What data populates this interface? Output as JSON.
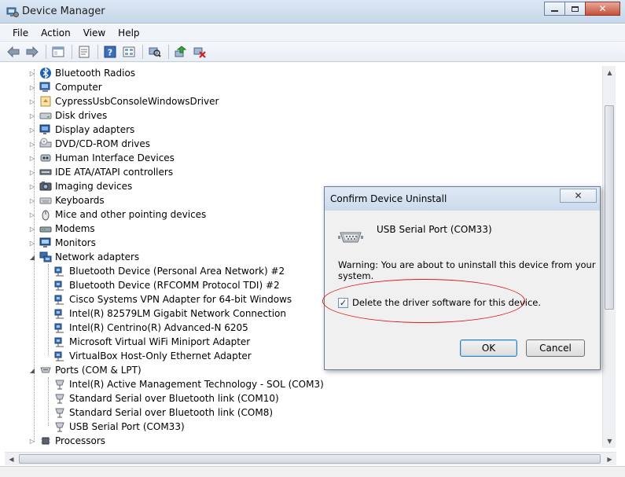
{
  "window": {
    "title": "Device Manager",
    "minimize_icon": "minimize-icon",
    "maximize_icon": "maximize-icon",
    "close_icon": "close-icon",
    "close_glyph": "✕"
  },
  "menu": [
    "File",
    "Action",
    "View",
    "Help"
  ],
  "toolbar": {
    "buttons": [
      "back-icon",
      "forward-icon",
      "console-tree-icon",
      "properties-icon",
      "help-icon",
      "view-icon",
      "scan-hardware-icon",
      "update-driver-icon",
      "uninstall-icon"
    ]
  },
  "tree": {
    "categories": [
      {
        "label": "Bluetooth Radios",
        "icon": "bluetooth-icon"
      },
      {
        "label": "Computer",
        "icon": "computer-icon"
      },
      {
        "label": "CypressUsbConsoleWindowsDriver",
        "icon": "driver-icon"
      },
      {
        "label": "Disk drives",
        "icon": "disk-drive-icon"
      },
      {
        "label": "Display adapters",
        "icon": "display-adapter-icon"
      },
      {
        "label": "DVD/CD-ROM drives",
        "icon": "dvd-drive-icon"
      },
      {
        "label": "Human Interface Devices",
        "icon": "hid-icon"
      },
      {
        "label": "IDE ATA/ATAPI controllers",
        "icon": "ide-controller-icon"
      },
      {
        "label": "Imaging devices",
        "icon": "camera-icon"
      },
      {
        "label": "Keyboards",
        "icon": "keyboard-icon"
      },
      {
        "label": "Mice and other pointing devices",
        "icon": "mouse-icon"
      },
      {
        "label": "Modems",
        "icon": "modem-icon"
      },
      {
        "label": "Monitors",
        "icon": "monitor-icon"
      }
    ],
    "network": {
      "label": "Network adapters",
      "icon": "network-adapter-icon",
      "children": [
        "Bluetooth Device (Personal Area Network) #2",
        "Bluetooth Device (RFCOMM Protocol TDI) #2",
        "Cisco Systems VPN Adapter for 64-bit Windows",
        "Intel(R) 82579LM Gigabit Network Connection",
        "Intel(R) Centrino(R) Advanced-N 6205",
        "Microsoft Virtual WiFi Miniport Adapter",
        "VirtualBox Host-Only Ethernet Adapter"
      ]
    },
    "ports": {
      "label": "Ports (COM & LPT)",
      "icon": "port-icon",
      "children": [
        "Intel(R) Active Management Technology - SOL (COM3)",
        "Standard Serial over Bluetooth link (COM10)",
        "Standard Serial over Bluetooth link (COM8)",
        "USB Serial Port (COM33)"
      ]
    },
    "processors": {
      "label": "Processors",
      "icon": "processor-icon"
    }
  },
  "dialog": {
    "title": "Confirm Device Uninstall",
    "close_glyph": "✕",
    "device_name": "USB Serial Port (COM33)",
    "device_icon": "serial-port-icon",
    "warning": "Warning: You are about to uninstall this device from your system.",
    "checkbox_label": "Delete the driver software for this device.",
    "checkbox_checked": true,
    "checkbox_glyph": "✓",
    "ok_label": "OK",
    "cancel_label": "Cancel"
  },
  "annotation_color": "#d81e1e"
}
